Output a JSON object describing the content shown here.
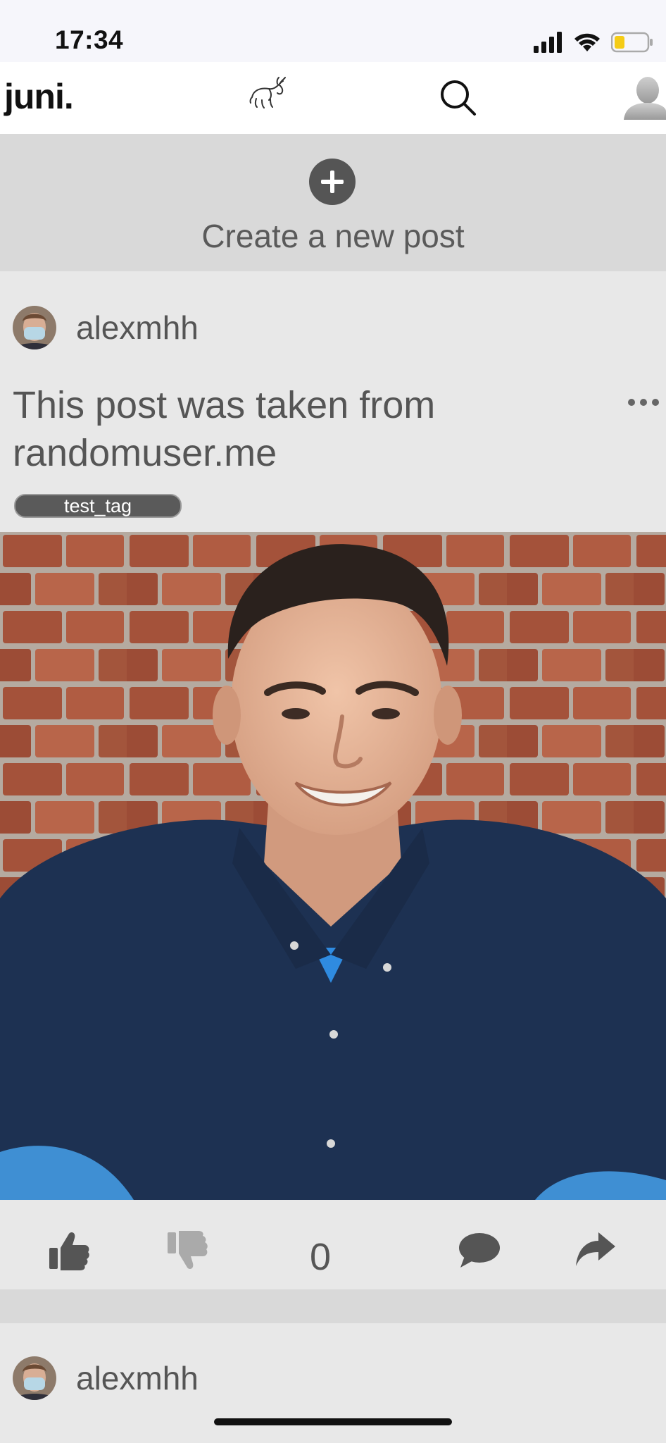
{
  "status_bar": {
    "time": "17:34"
  },
  "header": {
    "brand": "juni.",
    "logo_icon": "bull-logo-icon",
    "search_icon": "search-icon",
    "profile_icon": "user-avatar-icon"
  },
  "create_post": {
    "icon": "plus-circle-icon",
    "label": "Create a new post"
  },
  "posts": [
    {
      "author": "alexmhh",
      "title": "This post was taken from randomuser.me",
      "tags": [
        "test_tag"
      ],
      "score": "0",
      "image": "man-smiling-brick-wall-photo",
      "actions": [
        "thumbs-up-icon",
        "thumbs-down-icon",
        "comment-icon",
        "share-icon"
      ]
    },
    {
      "author": "alexmhh"
    }
  ],
  "colors": {
    "background": "#e8e8e8",
    "header_background": "#ffffff",
    "create_post_background": "#d9d9d9",
    "text": "#555555",
    "tag_background": "#5a5a5a",
    "dislike_inactive": "#aaaaaa"
  }
}
